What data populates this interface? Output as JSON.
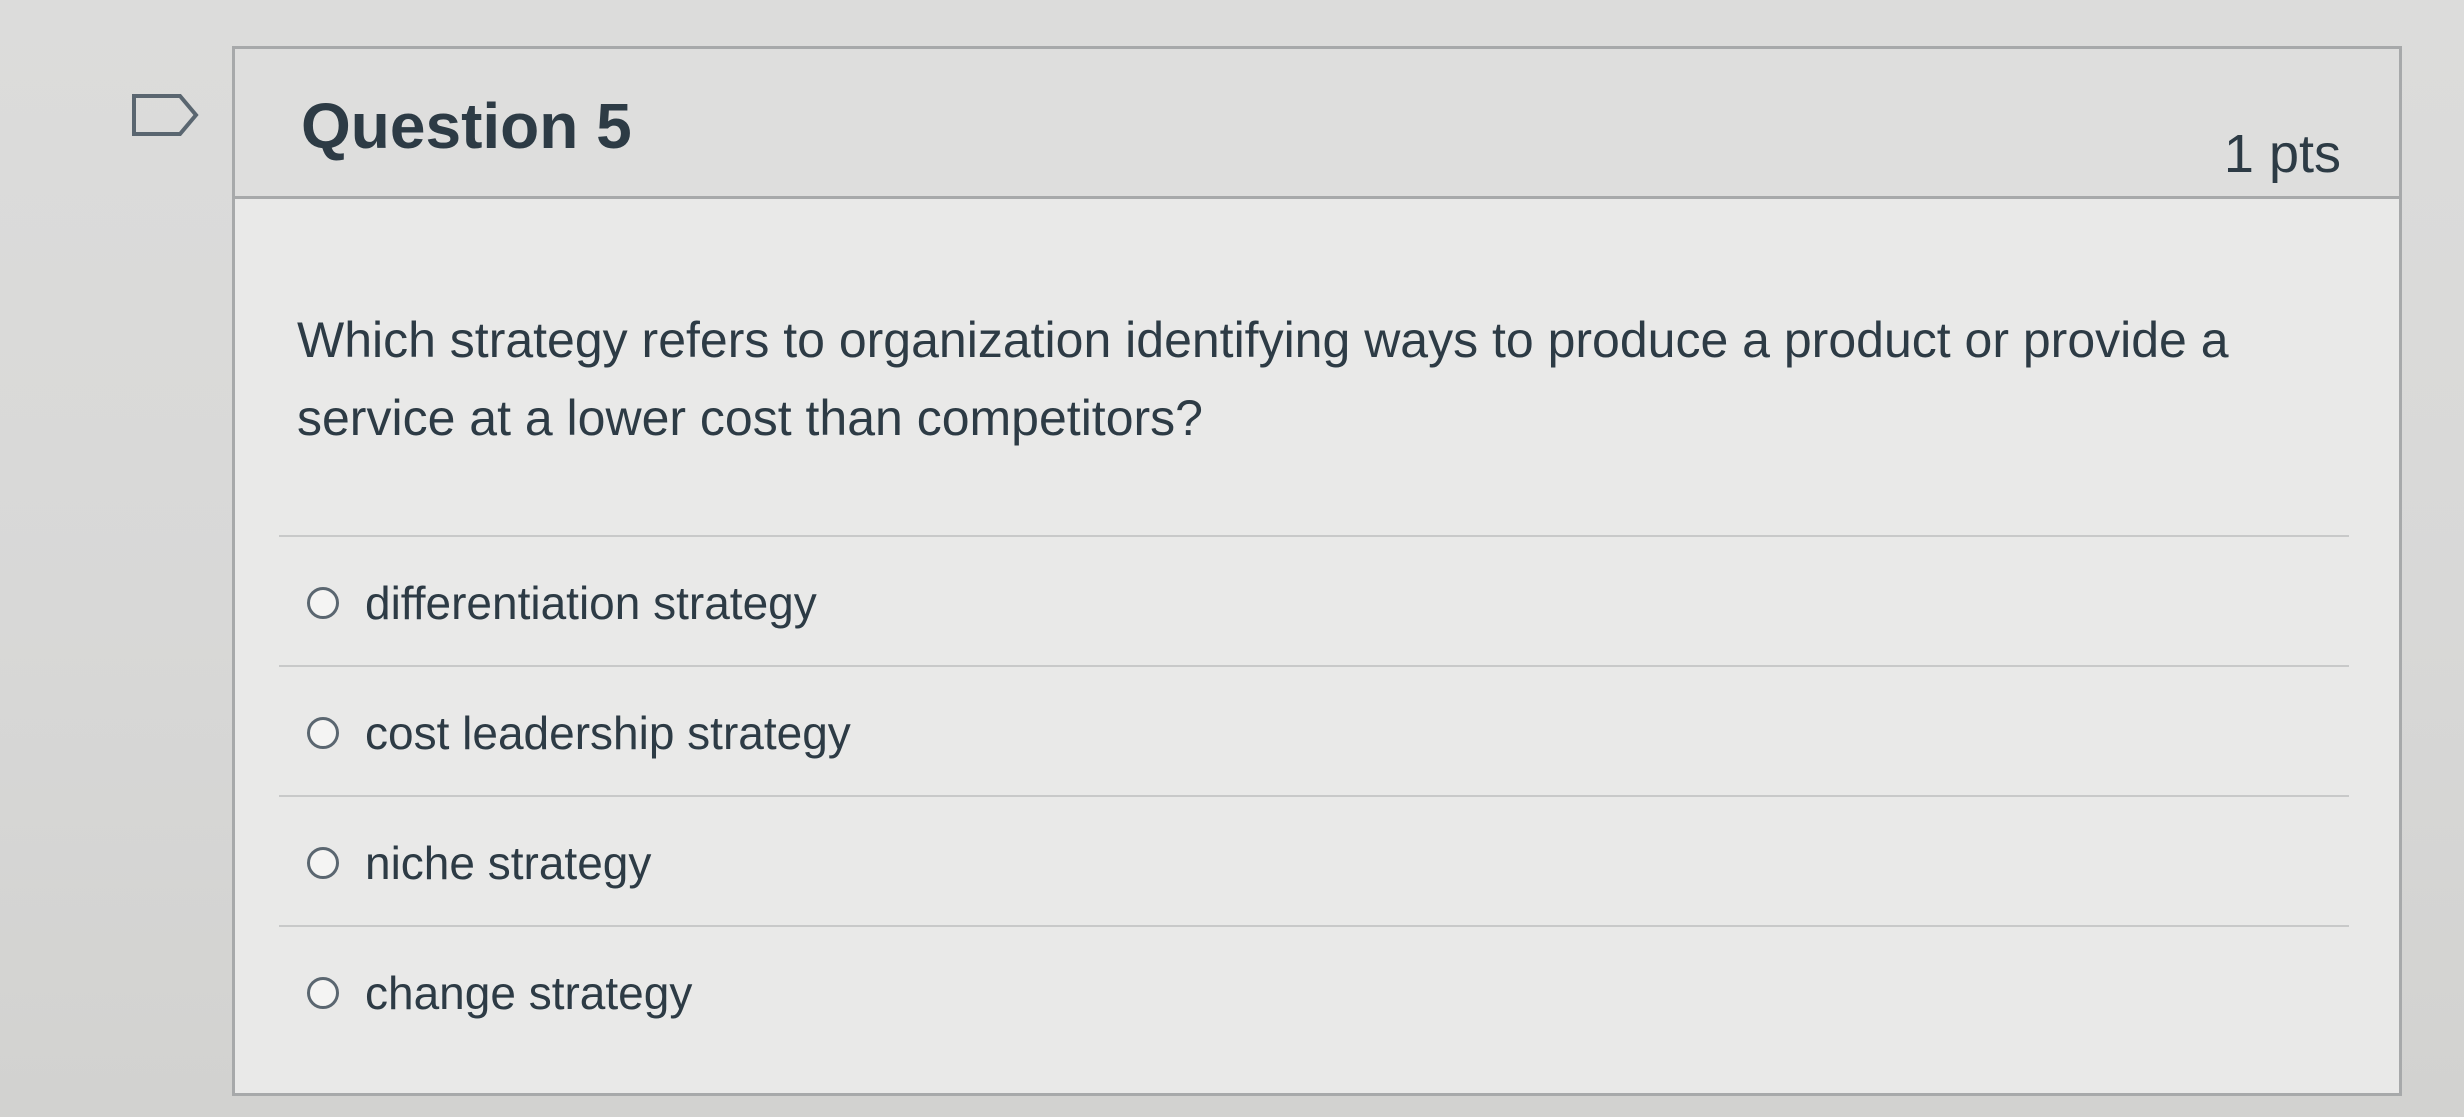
{
  "question": {
    "title": "Question 5",
    "points": "1 pts",
    "text": "Which strategy refers to organization identifying ways to produce a product or provide a service at a lower cost than competitors?",
    "answers": [
      {
        "label": "differentiation strategy",
        "selected": false
      },
      {
        "label": "cost leadership strategy",
        "selected": false
      },
      {
        "label": "niche strategy",
        "selected": false
      },
      {
        "label": "change strategy",
        "selected": false
      }
    ]
  },
  "icons": {
    "flag": "flag-icon"
  }
}
